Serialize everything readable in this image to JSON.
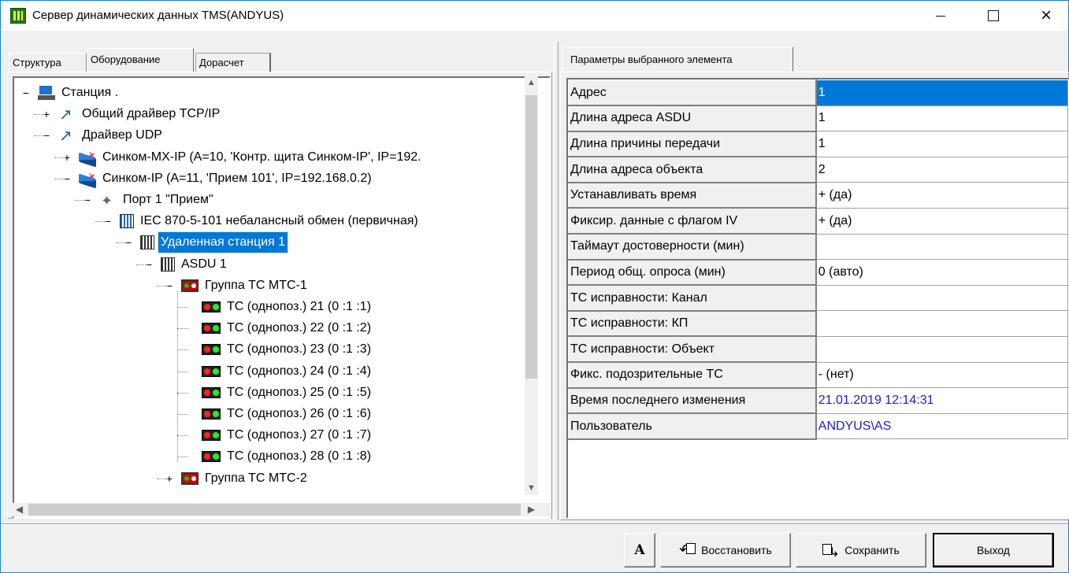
{
  "window": {
    "title": "Сервер динамических данных TMS(ANDYUS)",
    "icon": "tms-app-icon",
    "controls": {
      "minimize": "minimize",
      "maximize": "maximize",
      "close": "close"
    }
  },
  "left_tabs": [
    {
      "label": "Структура",
      "active": false
    },
    {
      "label": "Оборудование",
      "active": true
    },
    {
      "label": "Дорасчет",
      "active": false
    }
  ],
  "tree": [
    {
      "label": "Станция  .",
      "icon": "station-icon",
      "expander": "−"
    },
    {
      "label": "Общий драйвер TCP/IP",
      "icon": "driver-icon",
      "expander": "+"
    },
    {
      "label": "Драйвер UDP",
      "icon": "driver-icon",
      "expander": "−"
    },
    {
      "label": "Синком-МХ-IP  (A=10, 'Контр. щита Синком-IP', IP=192.",
      "icon": "device-icon",
      "expander": "+"
    },
    {
      "label": "Синком-IP  (A=11, 'Прием 101', IP=192.168.0.2)",
      "icon": "device-icon",
      "expander": "−"
    },
    {
      "label": "Порт 1  \"Прием\"",
      "icon": "port-icon",
      "expander": "−"
    },
    {
      "label": "IEC 870-5-101 небалансный обмен (первичная)",
      "icon": "protocol-icon",
      "expander": "−"
    },
    {
      "label": "Удаленная станция 1",
      "icon": "remote-station-icon",
      "expander": "−",
      "selected": true
    },
    {
      "label": "ASDU 1",
      "icon": "asdu-icon",
      "expander": "−"
    },
    {
      "label": "Группа ТС  МТС-1",
      "icon": "group-icon",
      "expander": "−"
    },
    {
      "label": "ТС (однопоз.)  21 (0 :1 :1)",
      "icon": "ts-icon"
    },
    {
      "label": "ТС (однопоз.)  22 (0 :1 :2)",
      "icon": "ts-icon"
    },
    {
      "label": "ТС (однопоз.)  23 (0 :1 :3)",
      "icon": "ts-icon"
    },
    {
      "label": "ТС (однопоз.)  24 (0 :1 :4)",
      "icon": "ts-icon"
    },
    {
      "label": "ТС (однопоз.)  25 (0 :1 :5)",
      "icon": "ts-icon"
    },
    {
      "label": "ТС (однопоз.)  26 (0 :1 :6)",
      "icon": "ts-icon"
    },
    {
      "label": "ТС (однопоз.)  27 (0 :1 :7)",
      "icon": "ts-icon"
    },
    {
      "label": "ТС (однопоз.)  28 (0 :1 :8)",
      "icon": "ts-icon"
    },
    {
      "label": "Группа ТС  МТС-2",
      "icon": "group-icon",
      "expander": "+"
    }
  ],
  "right_tab": {
    "label": "Параметры выбранного элемента"
  },
  "properties": [
    {
      "name": "Адрес",
      "value": "1",
      "selected": true
    },
    {
      "name": "Длина адреса ASDU",
      "value": "1"
    },
    {
      "name": "Длина причины передачи",
      "value": "1"
    },
    {
      "name": "Длина адреса объекта",
      "value": "2"
    },
    {
      "name": "Устанавливать время",
      "value": "+ (да)"
    },
    {
      "name": "Фиксир. данные с флагом IV",
      "value": "+ (да)"
    },
    {
      "name": "Таймаут достоверности (мин)",
      "value": ""
    },
    {
      "name": "Период общ. опроса (мин)",
      "value": "0 (авто)"
    },
    {
      "name": "ТС исправности: Канал",
      "value": ""
    },
    {
      "name": "ТС исправности: КП",
      "value": ""
    },
    {
      "name": "ТС исправности: Объект",
      "value": ""
    },
    {
      "name": "Фикс. подозрительные ТС",
      "value": "- (нет)"
    },
    {
      "name": "Время последнего изменения",
      "value": "21.01.2019 12:14:31",
      "color": "#1c1ccc"
    },
    {
      "name": "Пользователь",
      "value": "ANDYUS\\AS",
      "color": "#1c1ccc"
    }
  ],
  "buttons": {
    "font": "A",
    "restore": "Восстановить",
    "save": "Сохранить",
    "exit": "Выход"
  },
  "colors": {
    "selection": "#0078d7",
    "info_value": "#1c1ccc",
    "window_border": "#1883d7"
  }
}
